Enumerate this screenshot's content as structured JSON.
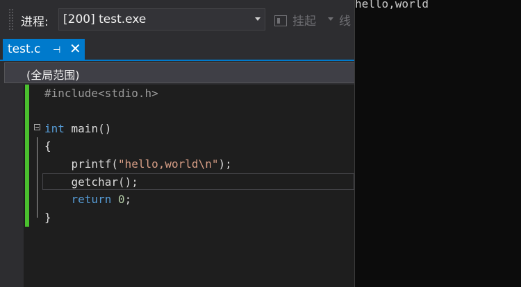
{
  "toolbar": {
    "process_label": "进程:",
    "process_value": "[200] test.exe",
    "suspend_label": "挂起",
    "thread_label": "线"
  },
  "tab": {
    "filename": "test.c",
    "pin_glyph": "⊣",
    "close_glyph": "✕"
  },
  "scope": {
    "text": "(全局范围)"
  },
  "editor": {
    "lines": [
      {
        "pp": "#include",
        "angle": "<stdio.h>"
      },
      {},
      {
        "kw": "int",
        "rest": " main()"
      },
      {
        "rest": "{"
      },
      {
        "indent": "    ",
        "fn": "printf(",
        "str": "\"hello,world\\n\"",
        "tail": ");"
      },
      {
        "indent": "    ",
        "fn": "getchar();"
      },
      {
        "indent": "    ",
        "kw": "return",
        "sp": " ",
        "num": "0",
        "tail": ";"
      },
      {
        "rest": "}"
      }
    ]
  },
  "console": {
    "output": "hello,world"
  },
  "colors": {
    "accent": "#007acc",
    "change_bar": "#4ac02e",
    "keyword": "#569cd6",
    "string": "#d69d85"
  }
}
